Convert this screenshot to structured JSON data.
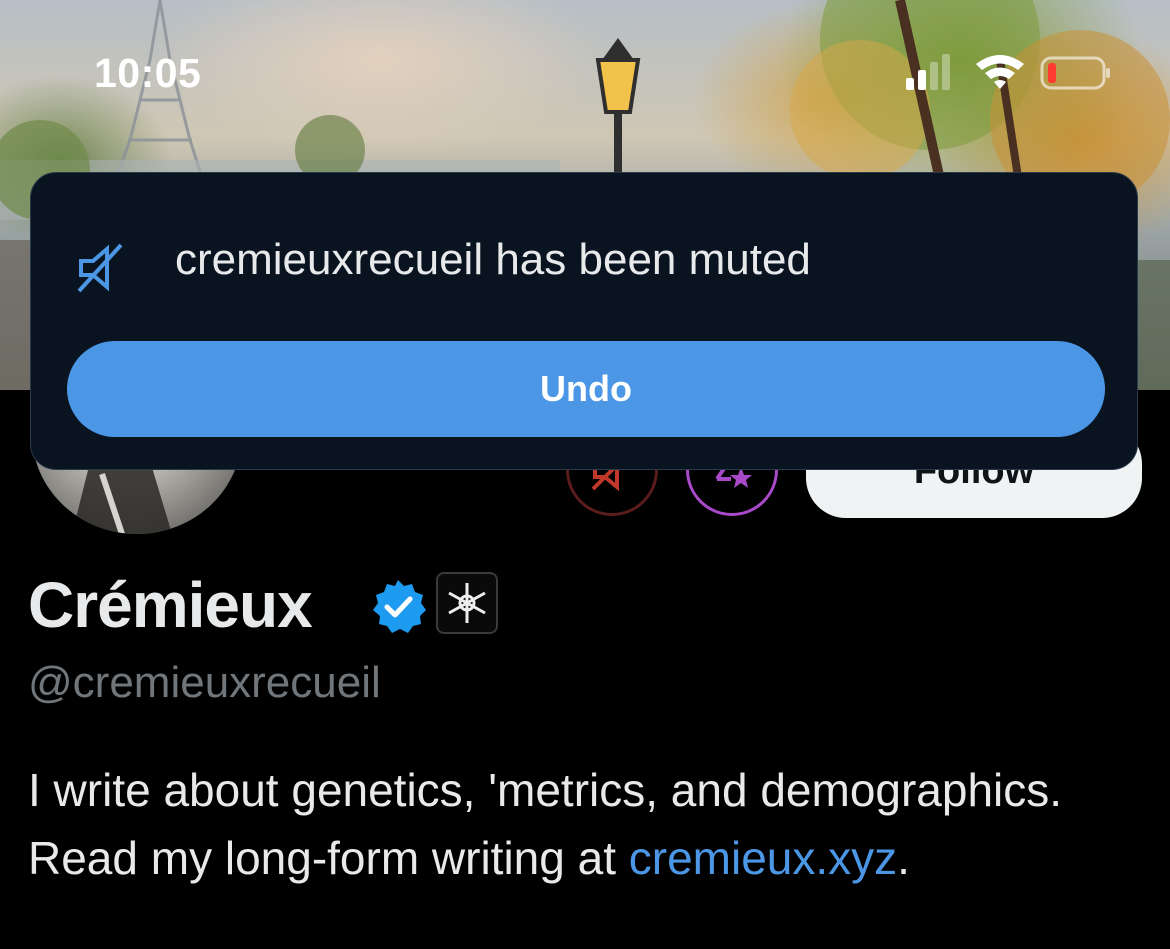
{
  "status_bar": {
    "time": "10:05"
  },
  "toast": {
    "message": "cremieuxrecueil has been muted",
    "undo_label": "Undo",
    "icon": "muted-speaker-icon"
  },
  "profile": {
    "display_name": "Crémieux",
    "handle": "@cremieuxrecueil",
    "follow_label": "Follow",
    "bio_text": "I write about genetics, 'metrics, and demographics. Read my long-form writing at ",
    "bio_link": "cremieuxrecueil.xyz",
    "bio_link_display": "cremieux.xyz",
    "bio_end": "."
  },
  "colors": {
    "accent": "#4c96e6",
    "toast_bg": "#0a1420",
    "text_primary": "#e7e9ea",
    "text_secondary": "#71767b",
    "mute_red": "#c0392b",
    "subscribe_purple": "#a84ac8"
  }
}
